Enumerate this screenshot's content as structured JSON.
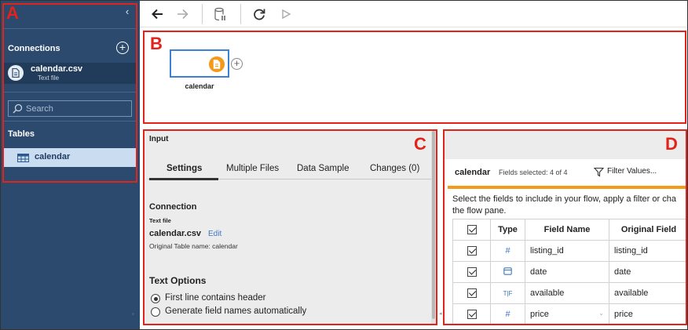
{
  "annotations": {
    "a": "A",
    "b": "B",
    "c": "C",
    "d": "D"
  },
  "sidebar": {
    "collapse_icon": "chevron-left-icon",
    "connections_label": "Connections",
    "add_icon": "plus-circle-icon",
    "connection": {
      "name": "calendar.csv",
      "type": "Text file"
    },
    "search_placeholder": "Search",
    "tables_label": "Tables",
    "table": {
      "name": "calendar"
    }
  },
  "toolbar": {
    "icons": [
      "back-arrow-icon",
      "forward-arrow-icon",
      "pause-updates-icon",
      "refresh-icon",
      "run-icon"
    ]
  },
  "flow": {
    "node_label": "calendar"
  },
  "input_panel": {
    "title": "Input",
    "tabs": [
      "Settings",
      "Multiple Files",
      "Data Sample",
      "Changes (0)"
    ],
    "active_tab": "Settings",
    "connection_heading": "Connection",
    "connection_type": "Text file",
    "file_name": "calendar.csv",
    "edit_label": "Edit",
    "original_table": "Original Table name: calendar",
    "text_options_heading": "Text Options",
    "option_header": "First line contains header",
    "option_generate": "Generate field names automatically",
    "selected_option": "First line contains header"
  },
  "fields_panel": {
    "name": "calendar",
    "fields_selected": "Fields selected: 4 of 4",
    "filter_label": "Filter Values...",
    "description_line1": "Select the fields to include in your flow, apply a filter or cha",
    "description_line2": "the flow pane.",
    "columns": [
      "Type",
      "Field Name",
      "Original Field"
    ],
    "rows": [
      {
        "type_icon": "number-icon",
        "type_glyph": "#",
        "field": "listing_id",
        "original": "listing_id"
      },
      {
        "type_icon": "date-icon",
        "type_glyph": "",
        "field": "date",
        "original": "date"
      },
      {
        "type_icon": "boolean-icon",
        "type_glyph": "T|F",
        "field": "available",
        "original": "available"
      },
      {
        "type_icon": "number-icon",
        "type_glyph": "#",
        "field": "price",
        "original": "price"
      }
    ]
  },
  "colors": {
    "sidebar_bg": "#2c4a6e",
    "annotation_red": "#e2231a",
    "accent_orange": "#f49a1a",
    "node_blue": "#3b82d6"
  }
}
